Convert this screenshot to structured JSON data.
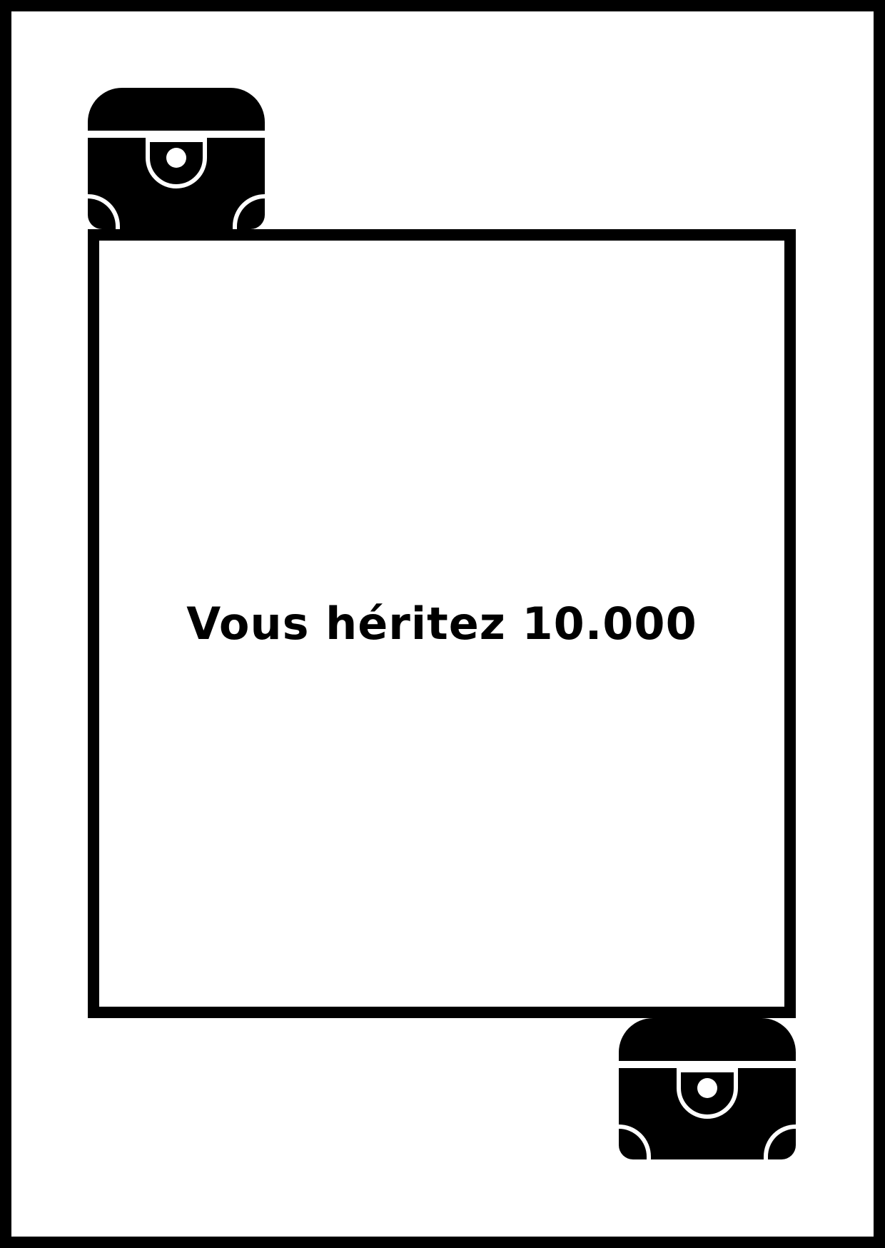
{
  "card": {
    "text": "Vous héritez 10.000",
    "background_color": "#ffffff",
    "ink_color": "#000000"
  },
  "icons": {
    "top_left": "treasure-chest-icon",
    "bottom_right": "treasure-chest-icon"
  }
}
